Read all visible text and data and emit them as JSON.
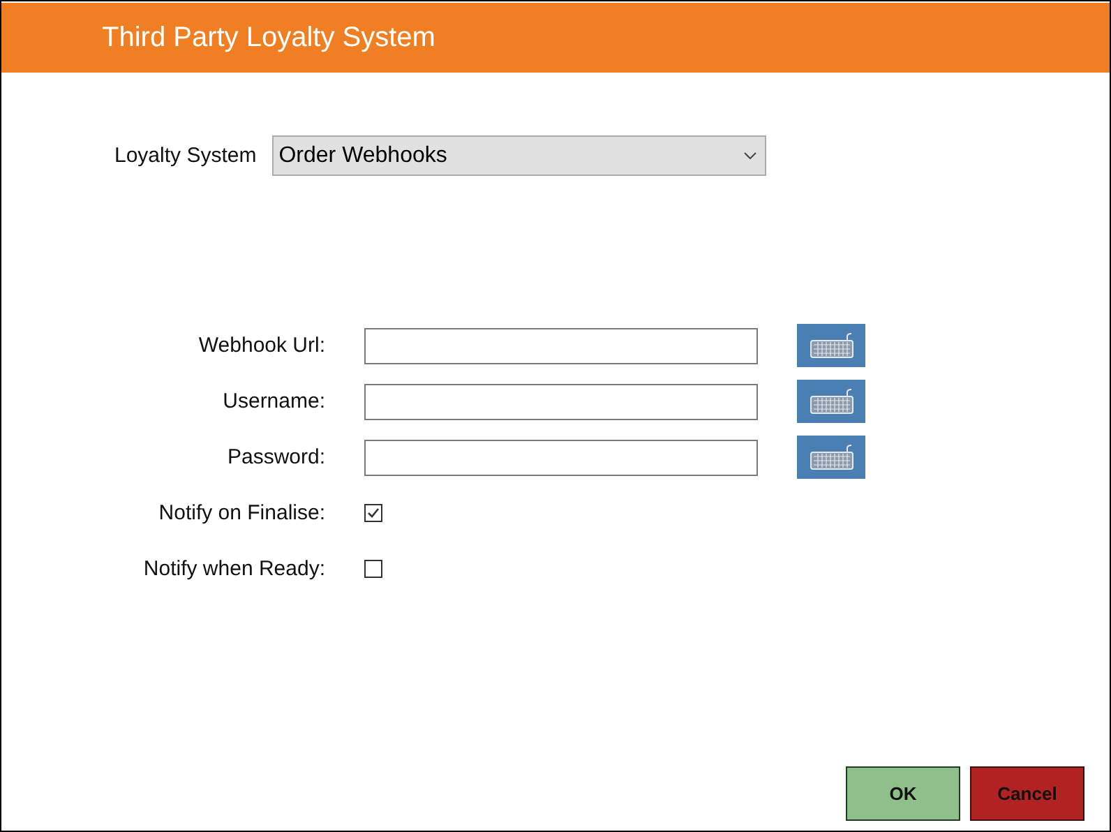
{
  "window": {
    "title": "Third Party Loyalty System"
  },
  "loyalty_system": {
    "label": "Loyalty System",
    "value": "Order Webhooks"
  },
  "fields": [
    {
      "kind": "text",
      "label": "Webhook Url:"
    },
    {
      "kind": "text",
      "label": "Username:"
    },
    {
      "kind": "text",
      "label": "Password:"
    },
    {
      "kind": "checkbox",
      "label": "Notify on Finalise:",
      "checked": true
    },
    {
      "kind": "checkbox",
      "label": "Notify when Ready:",
      "checked": false
    }
  ],
  "buttons": [
    {
      "kind": "ok",
      "label": "OK"
    },
    {
      "kind": "cancel",
      "label": "Cancel"
    }
  ]
}
